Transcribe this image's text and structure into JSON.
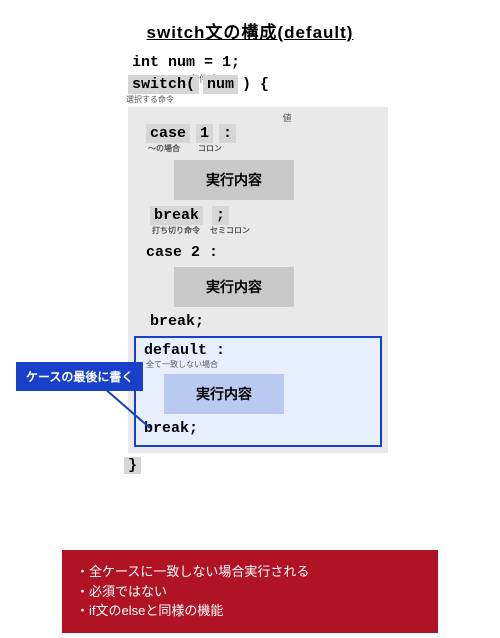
{
  "title": "switch文の構成(default)",
  "decl": "int num = 1;",
  "cond_label": "条件式",
  "switch_kw": "switch(",
  "num_token": "num",
  "close_paren": ") {",
  "sel_label": "選択する命令",
  "val_label": "値",
  "case1": {
    "kw": "case",
    "val": "1",
    "colon": ":",
    "sub_left": "～の場合",
    "sub_right": "コロン",
    "exec": "実行内容",
    "break_kw": "break",
    "break_semi": ";",
    "break_sub_left": "打ち切り命令",
    "break_sub_right": "セミコロン"
  },
  "case2": {
    "line": "case  2 :",
    "exec": "実行内容",
    "break": "break;"
  },
  "default_block": {
    "line": "default :",
    "sub": "全て一致しない場合",
    "exec": "実行内容",
    "break": "break;"
  },
  "close_brace": "}",
  "callout": "ケースの最後に書く",
  "notes": [
    "全ケースに一致しない場合実行される",
    "必須ではない",
    "if文のelseと同様の機能"
  ]
}
